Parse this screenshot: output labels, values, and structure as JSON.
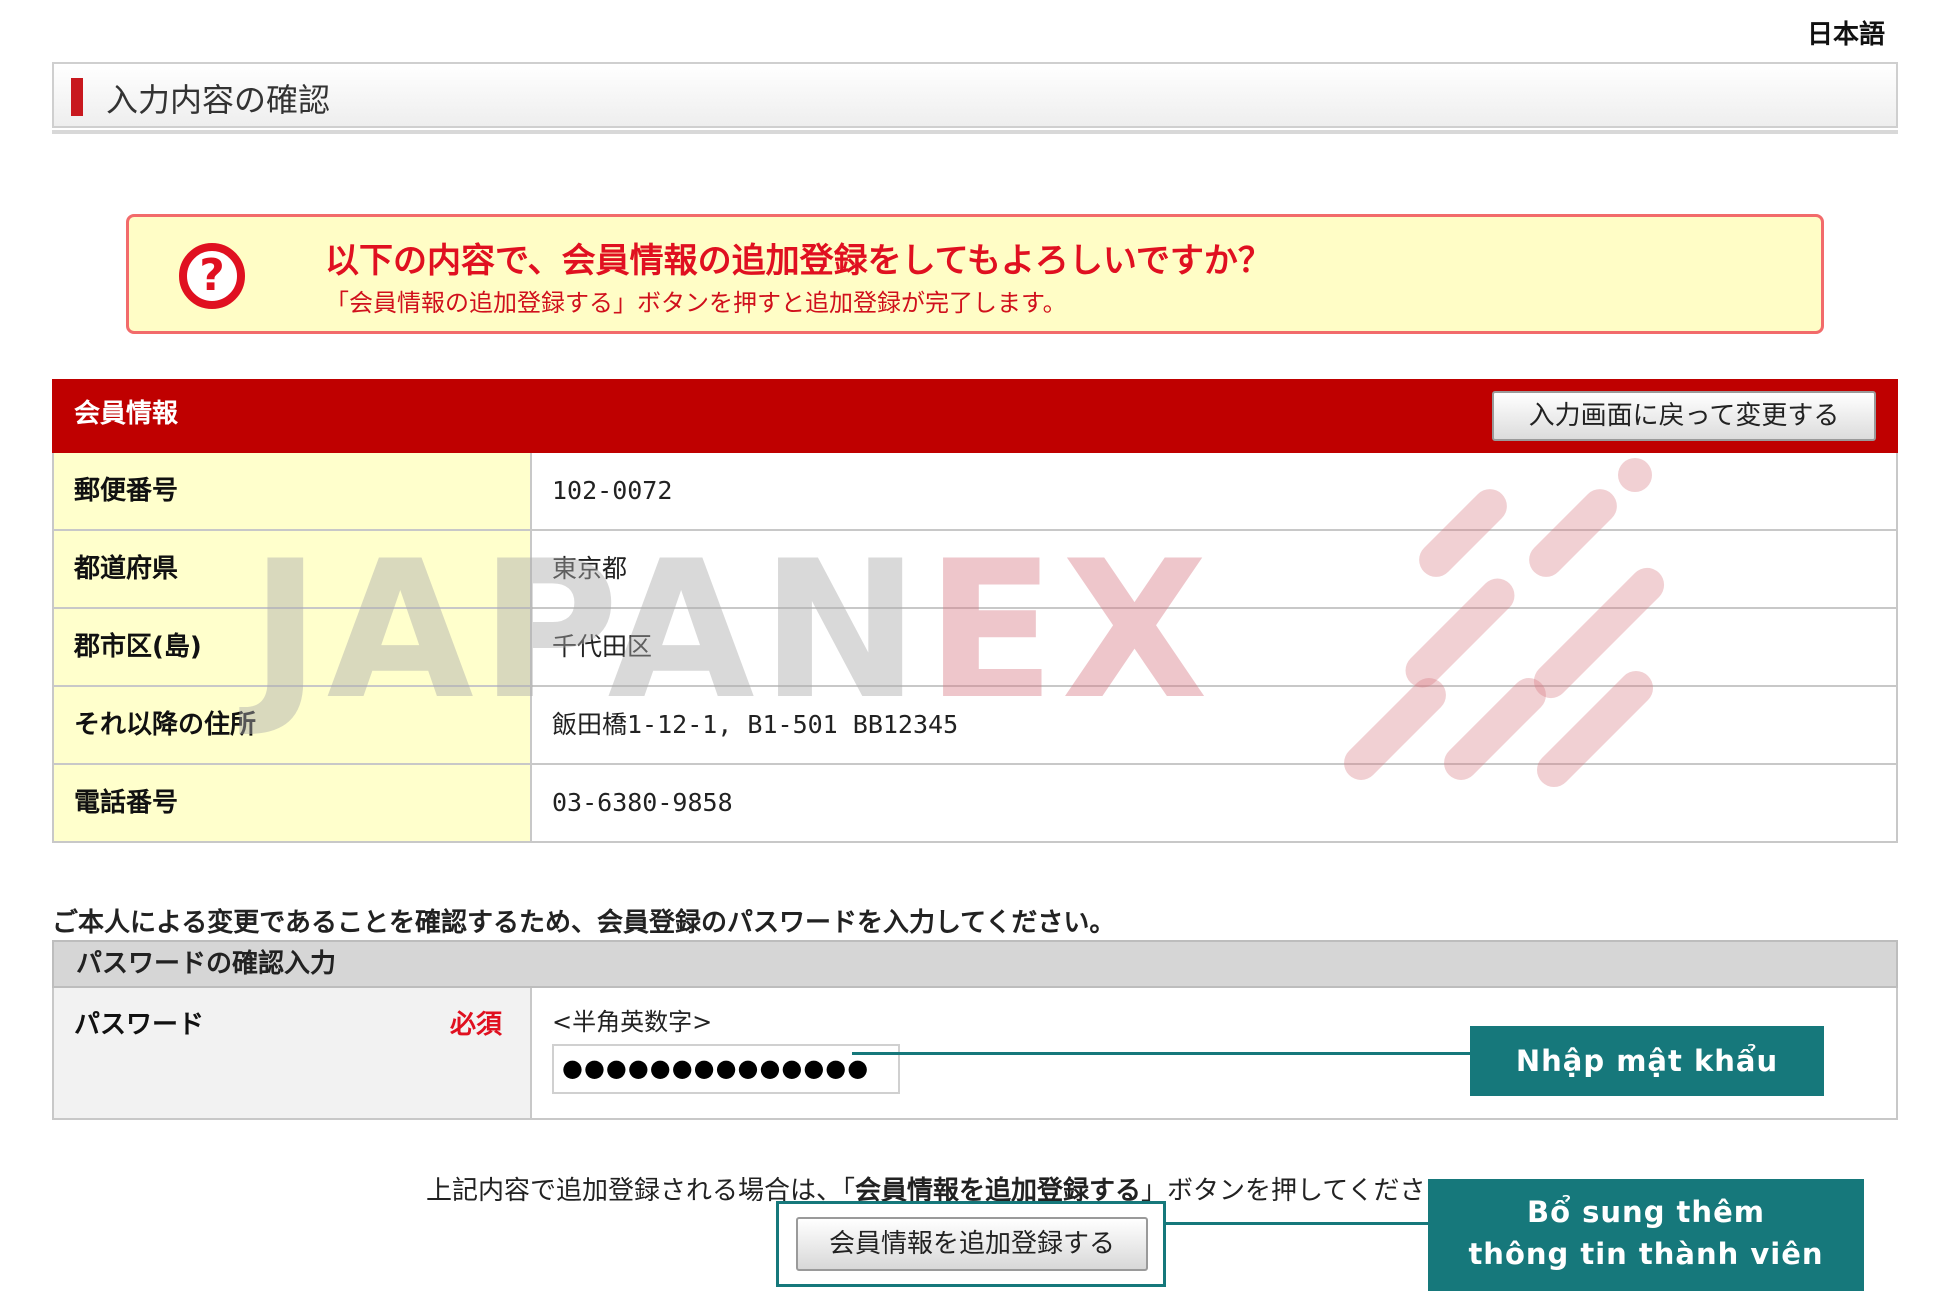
{
  "language": "日本語",
  "page_title": "入力内容の確認",
  "confirm": {
    "question": "以下の内容で、会員情報の追加登録をしてもよろしいですか？",
    "note": "「会員情報の追加登録する」ボタンを押すと追加登録が完了します。",
    "icon": "question-icon",
    "icon_color": "#e01020"
  },
  "member_info": {
    "title": "会員情報",
    "back_button": "入力画面に戻って変更する",
    "header_color": "#bf0000",
    "rows": [
      {
        "label": "郵便番号",
        "value": "102-0072"
      },
      {
        "label": "都道府県",
        "value": "東京都"
      },
      {
        "label": "郡市区(島)",
        "value": "千代田区"
      },
      {
        "label": "それ以降の住所",
        "value": "飯田橋1-12-1, B1-501 BB12345"
      },
      {
        "label": "電話番号",
        "value": "03-6380-9858"
      }
    ]
  },
  "password_section": {
    "instruction": "ご本人による変更であることを確認するため、会員登録のパスワードを入力してください。",
    "header": "パスワードの確認入力",
    "label": "パスワード",
    "required": "必須",
    "hint": "<半角英数字>",
    "value": "●●●●●●●●●●●●●●"
  },
  "submit": {
    "text_before": "上記内容で追加登録される場合は、「",
    "text_bold": "会員情報を追加登録する",
    "text_after": "」ボタンを押してください。",
    "button": "会員情報を追加登録する"
  },
  "annotations": {
    "password_callout": "Nhập mật khẩu",
    "add_callout_line1": "Bổ sung thêm",
    "add_callout_line2": "thông tin thành viên",
    "color": "#16787b"
  },
  "watermark": {
    "part1": "JAPAN",
    "part2": "EX"
  }
}
